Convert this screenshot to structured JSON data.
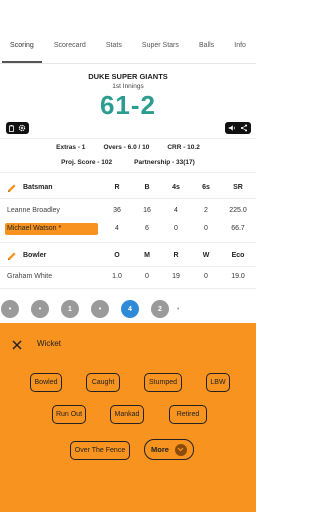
{
  "tabs": [
    {
      "label": "Scoring",
      "active": true
    },
    {
      "label": "Scorecard",
      "active": false
    },
    {
      "label": "Stats",
      "active": false
    },
    {
      "label": "Super Stars",
      "active": false
    },
    {
      "label": "Balls",
      "active": false
    },
    {
      "label": "Info",
      "active": false
    }
  ],
  "match": {
    "team": "DUKE SUPER GIANTS",
    "innings": "1st Innings",
    "score": "61-2"
  },
  "icons": {
    "left_pill": [
      "battery-icon",
      "settings-icon"
    ],
    "right_pill": [
      "volume-icon",
      "share-icon"
    ]
  },
  "stats": {
    "extras": "Extras - 1",
    "overs": "Overs - 6.0 / 10",
    "crr": "CRR - 10.2",
    "proj_score": "Proj. Score - 102",
    "partnership": "Partnership - 33(17)"
  },
  "batting": {
    "header": {
      "title": "Batsman",
      "r": "R",
      "b": "B",
      "fours": "4s",
      "sixes": "6s",
      "sr": "SR"
    },
    "rows": [
      {
        "name": "Leanne Broadley",
        "r": "36",
        "b": "16",
        "fours": "4",
        "sixes": "2",
        "sr": "225.0",
        "on_strike": false
      },
      {
        "name": "Michael Watson *",
        "r": "4",
        "b": "6",
        "fours": "0",
        "sixes": "0",
        "sr": "66.7",
        "on_strike": true
      }
    ]
  },
  "bowling": {
    "header": {
      "title": "Bowler",
      "o": "O",
      "m": "M",
      "r": "R",
      "w": "W",
      "eco": "Eco"
    },
    "rows": [
      {
        "name": "Graham White",
        "o": "1.0",
        "m": "0",
        "r": "19",
        "w": "0",
        "eco": "19.0"
      }
    ]
  },
  "balls": [
    {
      "label": "•",
      "current": false
    },
    {
      "label": "•",
      "current": false
    },
    {
      "label": "1",
      "current": false
    },
    {
      "label": "•",
      "current": false
    },
    {
      "label": "4",
      "current": true
    },
    {
      "label": "2",
      "current": false
    },
    {
      "label": "•",
      "separator": true
    }
  ],
  "wicket_sheet": {
    "title": "Wicket",
    "options": [
      "Bowled",
      "Caught",
      "Stumped",
      "LBW",
      "Run Out",
      "Mankad",
      "Retired",
      "Over The Fence"
    ],
    "more_label": "More"
  },
  "colors": {
    "accent": "#f7931e",
    "score": "#2a9d8f",
    "current_ball": "#2f8ad8",
    "ball": "#9a9a9a"
  }
}
